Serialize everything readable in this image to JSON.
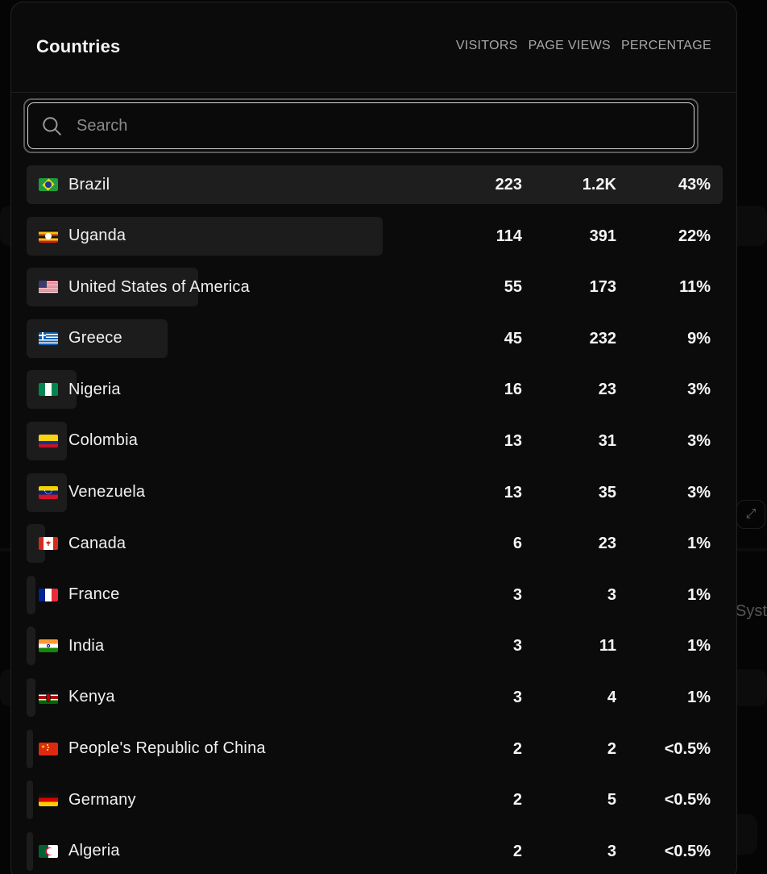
{
  "modal": {
    "title": "Countries",
    "columns": {
      "visitors": "VISITORS",
      "page_views": "PAGE VIEWS",
      "percentage": "PERCENTAGE"
    },
    "search": {
      "placeholder": "Search",
      "value": ""
    }
  },
  "background": {
    "partial_text": "Syst"
  },
  "rows": [
    {
      "country": "Brazil",
      "flag": "br",
      "visitors": "223",
      "page_views": "1.2K",
      "percentage": "43%",
      "share": 1.0
    },
    {
      "country": "Uganda",
      "flag": "ug",
      "visitors": "114",
      "page_views": "391",
      "percentage": "22%",
      "share": 0.511
    },
    {
      "country": "United States of America",
      "flag": "us",
      "visitors": "55",
      "page_views": "173",
      "percentage": "11%",
      "share": 0.246
    },
    {
      "country": "Greece",
      "flag": "gr",
      "visitors": "45",
      "page_views": "232",
      "percentage": "9%",
      "share": 0.202
    },
    {
      "country": "Nigeria",
      "flag": "ng",
      "visitors": "16",
      "page_views": "23",
      "percentage": "3%",
      "share": 0.072
    },
    {
      "country": "Colombia",
      "flag": "co",
      "visitors": "13",
      "page_views": "31",
      "percentage": "3%",
      "share": 0.058
    },
    {
      "country": "Venezuela",
      "flag": "ve",
      "visitors": "13",
      "page_views": "35",
      "percentage": "3%",
      "share": 0.058
    },
    {
      "country": "Canada",
      "flag": "ca",
      "visitors": "6",
      "page_views": "23",
      "percentage": "1%",
      "share": 0.027
    },
    {
      "country": "France",
      "flag": "fr",
      "visitors": "3",
      "page_views": "3",
      "percentage": "1%",
      "share": 0.013
    },
    {
      "country": "India",
      "flag": "in",
      "visitors": "3",
      "page_views": "11",
      "percentage": "1%",
      "share": 0.013
    },
    {
      "country": "Kenya",
      "flag": "ke",
      "visitors": "3",
      "page_views": "4",
      "percentage": "1%",
      "share": 0.013
    },
    {
      "country": "People's Republic of China",
      "flag": "cn",
      "visitors": "2",
      "page_views": "2",
      "percentage": "<0.5%",
      "share": 0.009
    },
    {
      "country": "Germany",
      "flag": "de",
      "visitors": "2",
      "page_views": "5",
      "percentage": "<0.5%",
      "share": 0.009
    },
    {
      "country": "Algeria",
      "flag": "dz",
      "visitors": "2",
      "page_views": "3",
      "percentage": "<0.5%",
      "share": 0.009
    }
  ]
}
